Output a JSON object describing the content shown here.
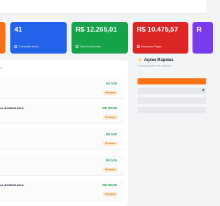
{
  "cards": [
    {
      "value": "",
      "label": ""
    },
    {
      "value": "41",
      "label": "Consultas ativas"
    },
    {
      "value": "R$ 12.265,01",
      "label": "Total de Receitas"
    },
    {
      "value": "R$ 10.475,57",
      "label": "Despesas Pagas"
    },
    {
      "value": "R",
      "label": ""
    }
  ],
  "list": {
    "header": "s",
    "rows": [
      {
        "name": "",
        "sub": "",
        "price": "R$ 0,00",
        "badge": "Pendente"
      },
      {
        "name": "AL BORRAS AZUL",
        "sub": "",
        "price": "R$ 700,00",
        "badge": "Pendente"
      },
      {
        "name": "",
        "sub": "",
        "price": "R$ 0,00",
        "badge": "Pendente"
      },
      {
        "name": "",
        "sub": "",
        "price": "R$ 0,00",
        "badge": "Pendente"
      },
      {
        "name": "AL BORRAS AZUL",
        "sub": "",
        "price": "R$ 200,00",
        "badge": "Pendente"
      }
    ]
  },
  "quick_actions": {
    "title": "Ações Rápidas",
    "subtitle": "Funcionalidades mais utilizadas",
    "buttons": [
      "",
      "",
      "",
      ""
    ]
  }
}
